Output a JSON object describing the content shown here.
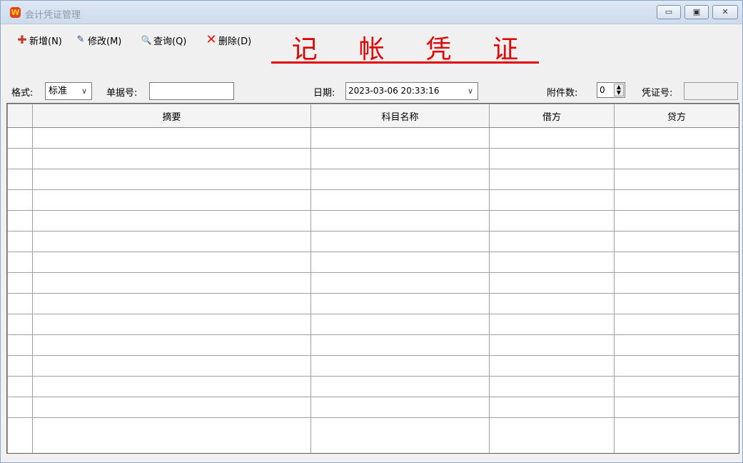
{
  "window": {
    "title": "会计凭证管理",
    "app_icon_glyph": "W",
    "min_glyph": "▭",
    "max_glyph": "▣",
    "close_glyph": "✕"
  },
  "toolbar": {
    "add_label": "新增(N)",
    "edit_label": "修改(M)",
    "query_label": "查询(Q)",
    "delete_label": "删除(D)",
    "add_icon_glyph": "✚",
    "edit_icon_glyph": "✎",
    "query_icon_glyph": "🔍",
    "delete_icon_glyph": "✕"
  },
  "voucher_title": [
    "记",
    "帐",
    "凭",
    "证"
  ],
  "filters": {
    "format_label": "格式:",
    "format_value": "标准",
    "bill_label": "单据号:",
    "bill_value": "",
    "date_label": "日期:",
    "date_value": "2023-03-06 20:33:16",
    "attach_label": "附件数:",
    "attach_value": "0",
    "voucher_no_label": "凭证号:",
    "voucher_no_value": "",
    "chevron_glyph": "∨",
    "spin_up_glyph": "▲",
    "spin_down_glyph": "▼"
  },
  "grid": {
    "columns": [
      "",
      "摘要",
      "科目名称",
      "借方",
      "贷方"
    ],
    "empty_rows": 14
  },
  "colors": {
    "title_red": "#e00000",
    "titlebar": "#dde8f4",
    "grid_line": "#a0a0a0"
  }
}
